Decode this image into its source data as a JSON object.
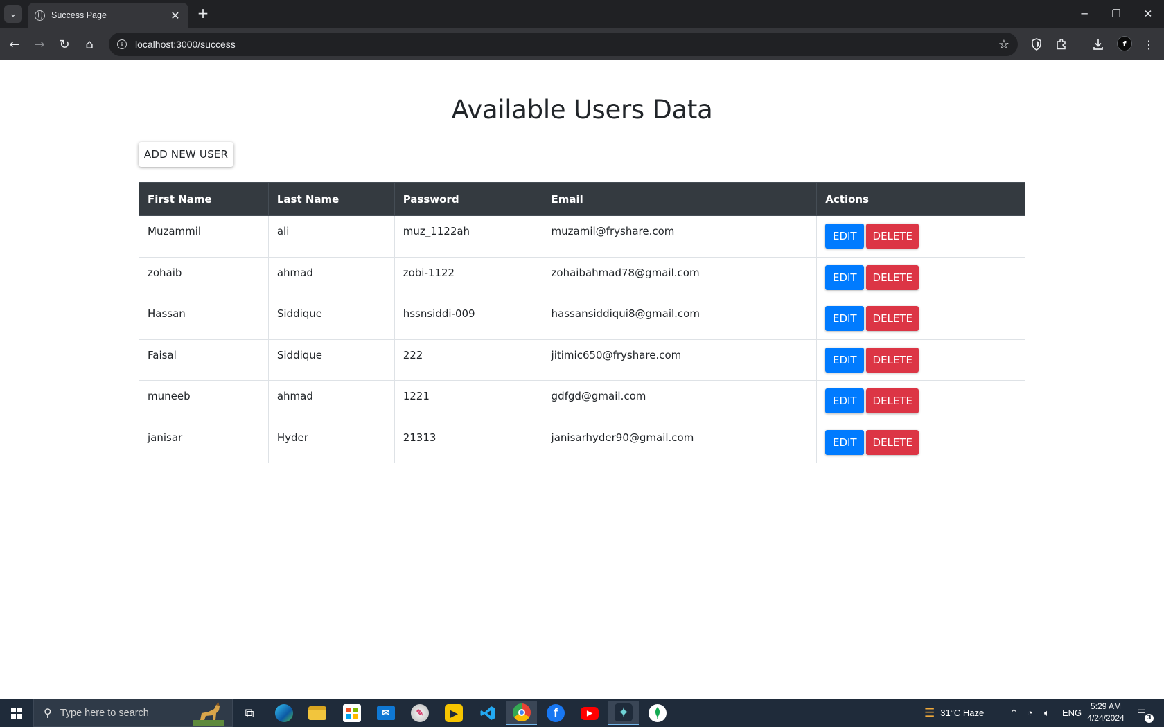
{
  "browser": {
    "tab_title": "Success Page",
    "tab_close": "✕",
    "new_tab": "+",
    "url": "localhost:3000/success",
    "window_controls": {
      "minimize": "─",
      "restore": "❐",
      "close": "✕"
    }
  },
  "page": {
    "title": "Available Users Data",
    "add_button_label": "ADD NEW USER"
  },
  "table": {
    "headers": {
      "first_name": "First Name",
      "last_name": "Last Name",
      "password": "Password",
      "email": "Email",
      "actions": "Actions"
    },
    "edit_label": "EDIT",
    "delete_label": "DELETE",
    "rows": [
      {
        "first_name": "Muzammil",
        "last_name": "ali",
        "password": "muz_1122ah",
        "email": "muzamil@fryshare.com"
      },
      {
        "first_name": "zohaib",
        "last_name": "ahmad",
        "password": "zobi-1122",
        "email": "zohaibahmad78@gmail.com"
      },
      {
        "first_name": "Hassan",
        "last_name": "Siddique",
        "password": "hssnsiddi-009",
        "email": "hassansiddiqui8@gmail.com"
      },
      {
        "first_name": "Faisal",
        "last_name": "Siddique",
        "password": "222",
        "email": "jitimic650@fryshare.com"
      },
      {
        "first_name": "muneeb",
        "last_name": "ahmad",
        "password": "1221",
        "email": "gdfgd@gmail.com"
      },
      {
        "first_name": "janisar",
        "last_name": "Hyder",
        "password": "21313",
        "email": "janisarhyder90@gmail.com"
      }
    ]
  },
  "taskbar": {
    "search_placeholder": "Type here to search",
    "weather": "31°C  Haze",
    "language": "ENG",
    "time": "5:29 AM",
    "date": "4/24/2024",
    "notification_count": "3"
  },
  "colors": {
    "edit": "#007bff",
    "delete": "#dc3545",
    "table_header": "#343a40"
  }
}
